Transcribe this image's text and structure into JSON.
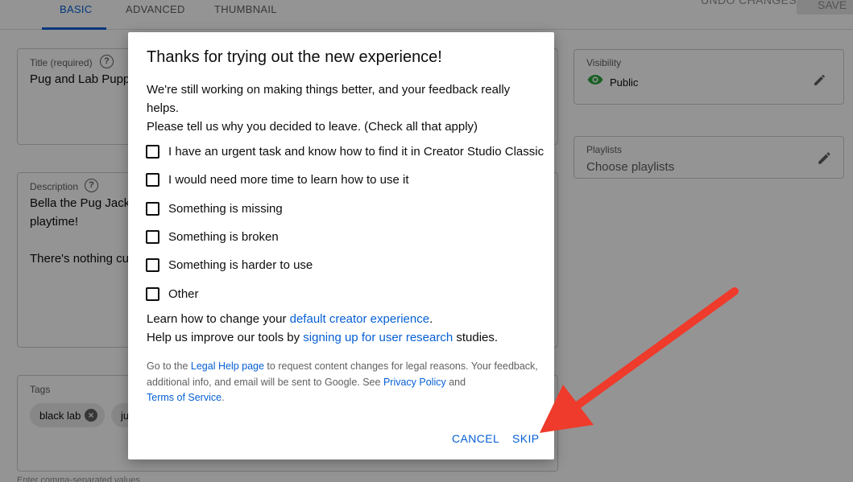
{
  "tabs": [
    {
      "label": "BASIC",
      "active": true
    },
    {
      "label": "ADVANCED",
      "active": false
    },
    {
      "label": "THUMBNAIL",
      "active": false
    }
  ],
  "header": {
    "undo_label": "UNDO CHANGES",
    "save_label": "SAVE"
  },
  "form": {
    "title": {
      "label": "Title (required)",
      "value": "Pug and Lab Puppy"
    },
    "description": {
      "label": "Description",
      "line1": "Bella the Pug Jack",
      "line2": "playtime!",
      "line3": "There's nothing cut"
    },
    "tags": {
      "label": "Tags",
      "chips": [
        "black lab",
        "ju"
      ],
      "hint": "Enter comma-separated values"
    },
    "visibility": {
      "label": "Visibility",
      "value": "Public"
    },
    "playlists": {
      "label": "Playlists",
      "value": "Choose playlists"
    }
  },
  "dialog": {
    "title": "Thanks for trying out the new experience!",
    "intro_line1": "We're still working on making things better, and your feedback really helps.",
    "intro_line2": "Please tell us why you decided to leave. (Check all that apply)",
    "options": [
      "I have an urgent task and know how to find it in Creator Studio Classic",
      "I would need more time to learn how to use it",
      "Something is missing",
      "Something is broken",
      "Something is harder to use",
      "Other"
    ],
    "learn": {
      "prefix": "Learn how to change your ",
      "link": "default creator experience",
      "suffix": "."
    },
    "research": {
      "prefix": "Help us improve our tools by ",
      "link": "signing up for user research",
      "suffix": " studies."
    },
    "legal": {
      "t1": "Go to the ",
      "link1": "Legal Help page",
      "t2": " to request content changes for legal reasons. Your feedback, additional info, and email will be sent to Google. See ",
      "link2": "Privacy Policy",
      "t3": " and ",
      "link3": "Terms of Service",
      "t4": "."
    },
    "cancel_label": "CANCEL",
    "skip_label": "SKIP"
  },
  "colors": {
    "accent": "#065fd4",
    "annotation_arrow": "#ee3b2b",
    "visibility_icon": "#2ba640"
  },
  "icons": [
    "help-circle-icon",
    "eye-icon",
    "pencil-icon",
    "close-circle-icon",
    "annotation-arrow"
  ]
}
